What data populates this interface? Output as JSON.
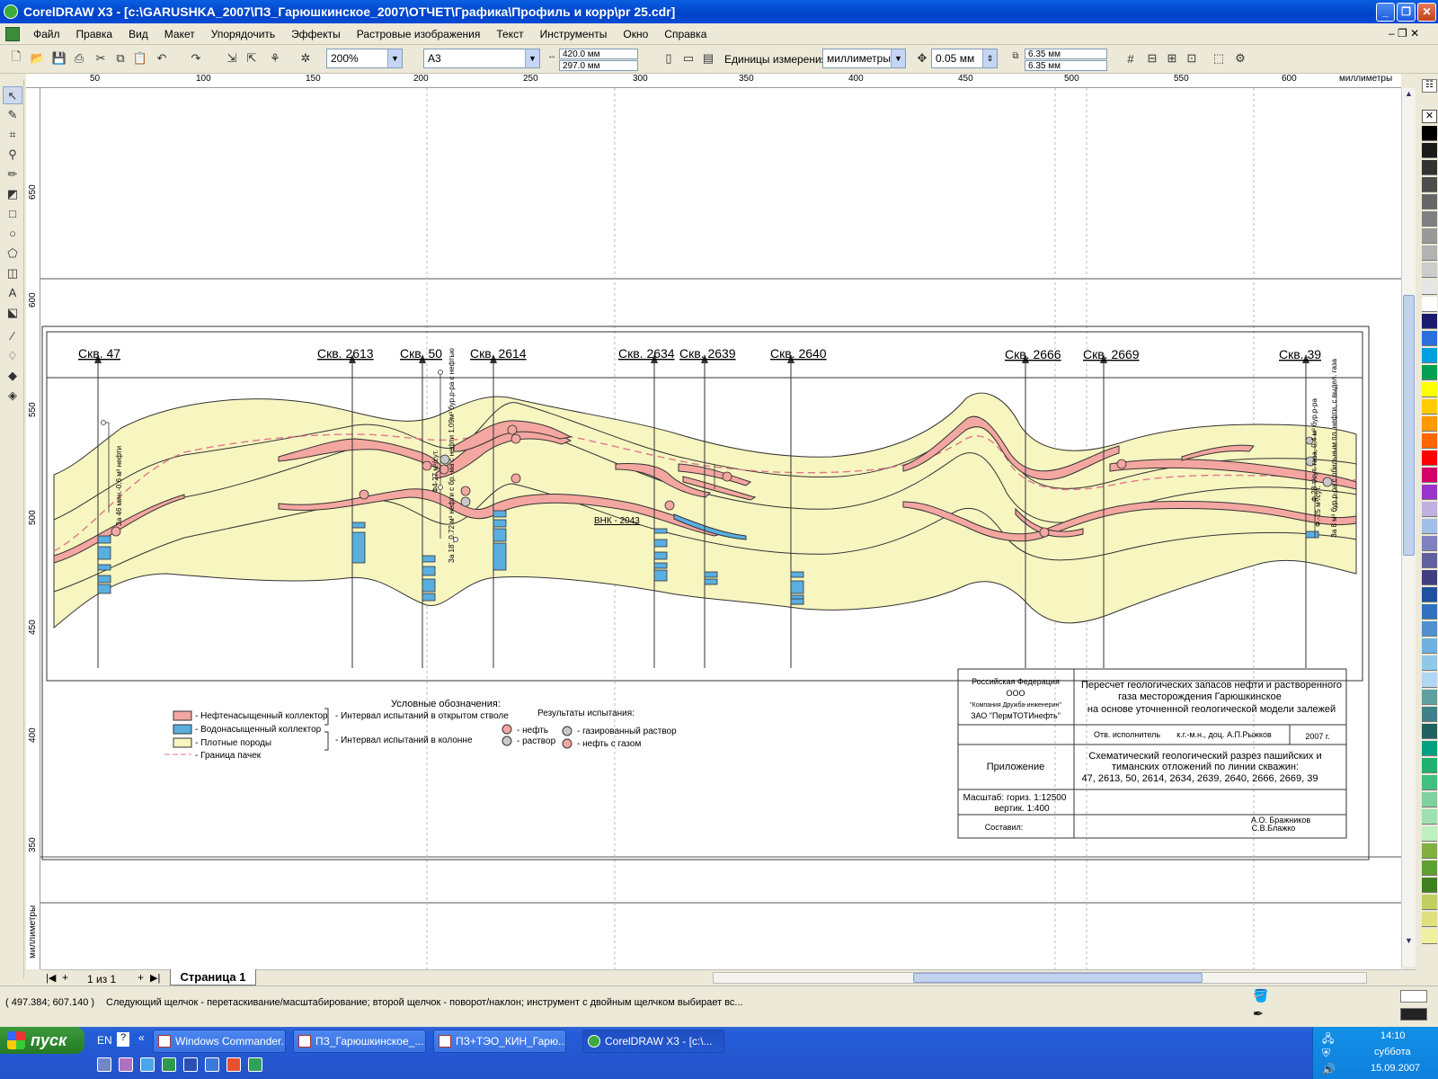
{
  "window": {
    "title": "CorelDRAW X3 - [c:\\GARUSHKA_2007\\ПЗ_Гарюшкинское_2007\\ОТЧЕТ\\Графика\\Профиль и корр\\pr 25.cdr]"
  },
  "menu": [
    "Файл",
    "Правка",
    "Вид",
    "Макет",
    "Упорядочить",
    "Эффекты",
    "Растровые изображения",
    "Текст",
    "Инструменты",
    "Окно",
    "Справка"
  ],
  "toolbar": {
    "zoom": "200%",
    "paper": "A3",
    "width": "420.0 мм",
    "height": "297.0 мм",
    "units_label": "Единицы измерения:",
    "units": "миллиметры",
    "nudge": "0.05 мм",
    "dup_x": "6.35 мм",
    "dup_y": "6.35 мм"
  },
  "ruler": {
    "top": [
      "50",
      "100",
      "150",
      "200",
      "250",
      "300",
      "350",
      "400",
      "450",
      "500",
      "550",
      "600"
    ],
    "unit": "миллиметры",
    "left": [
      "650",
      "600",
      "550",
      "500",
      "450",
      "400",
      "350"
    ],
    "left_unit": "миллиметры"
  },
  "drawing": {
    "wells": [
      "Скв. 47",
      "Скв. 2613",
      "Скв. 50",
      "Скв. 2614",
      "Скв. 2634",
      "Скв. 2639",
      "Скв. 2640",
      "Скв. 2666",
      "Скв. 2669",
      "Скв. 39"
    ],
    "vnk": "ВНК - 2043",
    "annotations": [
      "За 46 мин.-0,6 м³ нефти",
      "Ф4-27 м³/сут.",
      "За 18', 0.72 м³ нефти с бр.-ма с нефти 1,09м³ бур.р-ра с нефтью",
      "Ф.-25 м³/сут.",
      "Ф.28 т/сут. газа, 0,4 м³ бур.р-ра",
      "За 8 м³ бур.р-ра с обильным пл. нефти, с выдел. газа"
    ],
    "legend_title": "Условные обозначения:",
    "legend_items": [
      "- Нефтенасыщенный коллектор",
      "- Водонасыщенный коллектор",
      "- Плотные породы",
      "- Граница пачек"
    ],
    "interval_items": [
      "- Интервал испытаний в открытом стволе",
      "- Интервал испытаний в колонне"
    ],
    "results_title": "Результаты испытания:",
    "results_items": [
      "- нефть",
      "- раствор",
      "- газированный раствор",
      "- нефть с газом"
    ],
    "stamp": {
      "org1": "Российская Федерация",
      "org2": "ООО",
      "org3": "\"Компания Дружба-инженерин\"",
      "org4": "ЗАО \"ПермТОТИнефть\"",
      "main1": "Пересчет геологических запасов нефти и растворенного",
      "main2": "газа  месторождения Гарюшкинское",
      "main3": "на основе уточненной геологической модели залежей",
      "resp": "Отв. исполнитель",
      "resp_name": "к.г.-м.н., доц. А.П.Рыжков",
      "year": "2007 г.",
      "appendix": "Приложение",
      "desc1": "Схематический геологический разрез пашийских и",
      "desc2": "тиманских отложений по линии скважин:",
      "desc3": "47, 2613, 50, 2614, 2634, 2639, 2640, 2666, 2669, 39",
      "scale1": "Масштаб: гориз. 1:12500",
      "scale2": "вертик. 1:400",
      "compiled": "Составил:",
      "auth1": "А.О. Бражников",
      "auth2": "С.В.Блажко"
    }
  },
  "pager": {
    "pos": "1 из 1",
    "tab": "Страница 1"
  },
  "status": {
    "coords": "( 497.384; 607.140 )",
    "hint": "Следующий щелчок - перетаскивание/масштабирование; второй щелчок - поворот/наклон; инструмент с двойным щелчком выбирает вс..."
  },
  "taskbar": {
    "start": "пуск",
    "lang": "EN",
    "tasks": [
      "Windows Commander...",
      "ПЗ_Гарюшкинское_...",
      "ПЗ+ТЭО_КИН_Гарю...",
      "CorelDRAW X3 - [c:\\..."
    ],
    "time": "14:10",
    "day": "суббота",
    "date": "15.09.2007"
  },
  "colors": {
    "title_blue": "#0a5fe0",
    "oil": "#f4a6a0",
    "water": "#5aaee0",
    "dense": "#f7f5c0"
  }
}
